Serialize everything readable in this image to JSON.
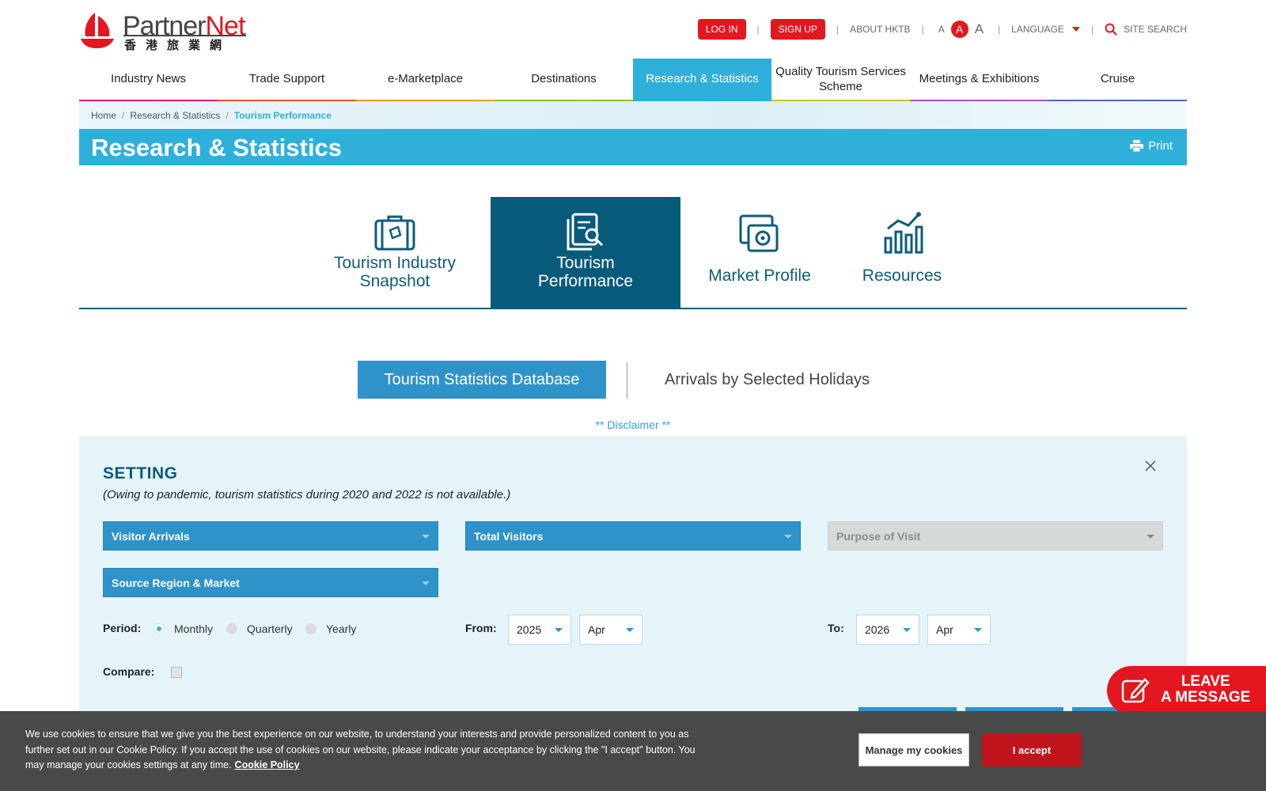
{
  "header": {
    "logo_brand_a": "Partner",
    "logo_brand_b": "Net",
    "logo_cn": "香港旅業網",
    "login": "LOG IN",
    "signup": "SIGN UP",
    "about": "ABOUT HKTB",
    "font_small": "A",
    "font_mid": "A",
    "font_big": "A",
    "language": "LANGUAGE",
    "site_search": "SITE SEARCH"
  },
  "nav": [
    {
      "label": "Industry News",
      "color": "#d6246e"
    },
    {
      "label": "Trade Support",
      "color": "#e8542b"
    },
    {
      "label": "e-Marketplace",
      "color": "#f29b1d"
    },
    {
      "label": "Destinations",
      "color": "#8dbf2f"
    },
    {
      "label": "Research & Statistics",
      "color": "#2fb0da"
    },
    {
      "label": "Quality Tourism Services Scheme",
      "color": "#c7c22a"
    },
    {
      "label": "Meetings & Exhibitions",
      "color": "#a354c7"
    },
    {
      "label": "Cruise",
      "color": "#5163c9"
    }
  ],
  "breadcrumb": [
    "Home",
    "Research & Statistics",
    "Tourism Performance"
  ],
  "page_title": "Research & Statistics",
  "print_label": "Print",
  "categories": [
    {
      "label": "Tourism Industry Snapshot",
      "icon": "luggage-icon"
    },
    {
      "label": "Tourism Performance",
      "icon": "document-search-icon"
    },
    {
      "label": "Market Profile",
      "icon": "market-profile-icon"
    },
    {
      "label": "Resources",
      "icon": "chart-icon"
    }
  ],
  "subtabs": [
    "Tourism Statistics Database",
    "Arrivals by Selected Holidays"
  ],
  "disclaimer": "** Disclaimer **",
  "setting": {
    "title": "SETTING",
    "note": "(Owing to pandemic, tourism statistics during 2020 and 2022 is not available.)",
    "select_arrivals": "Visitor Arrivals",
    "select_visitors": "Total Visitors",
    "select_purpose": "Purpose of Visit",
    "select_source": "Source Region & Market",
    "period_label": "Period:",
    "period_options": [
      "Monthly",
      "Quarterly",
      "Yearly"
    ],
    "period_selected": "Monthly",
    "from_label": "From:",
    "from_year": "2025",
    "from_month": "Apr",
    "to_label": "To:",
    "to_year": "2026",
    "to_month": "Apr",
    "compare_label": "Compare:"
  },
  "leave_message": {
    "line1": "LEAVE",
    "line2": "A MESSAGE"
  },
  "cookie": {
    "message": "We use cookies to ensure that we give you the best experience on our website, to understand your interests and provide personalized content to you as further set out in our Cookie Policy. If you accept the use of cookies on our website, please indicate your acceptance by clicking the \"I accept\" button. You may manage your cookies settings at any time.",
    "policy_link": "Cookie Policy",
    "manage": "Manage my cookies",
    "accept": "I accept"
  },
  "colors": {
    "brand_red": "#e4161f",
    "accent_blue": "#2fb0da",
    "deep_teal": "#085a7b",
    "select_blue": "#2f93c9"
  }
}
